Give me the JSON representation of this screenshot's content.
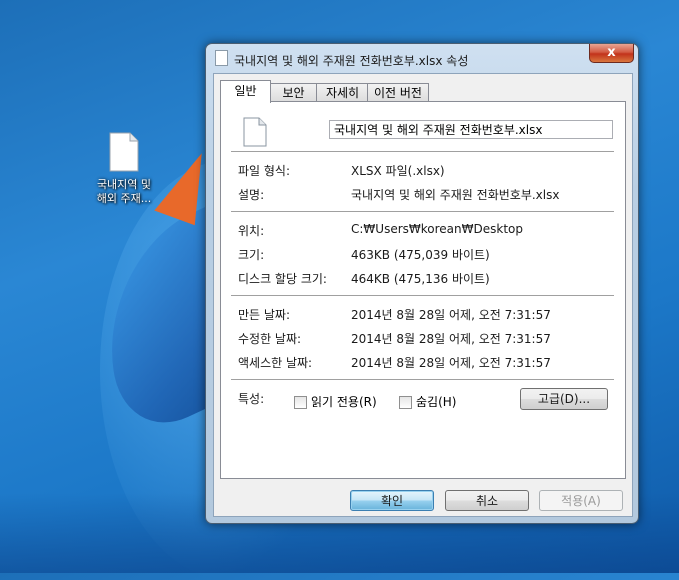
{
  "desktop": {
    "icon_label_line1": "국내지역 및",
    "icon_label_line2": "해외 주재..."
  },
  "window": {
    "title": "국내지역 및 해외 주재원 전화번호부.xlsx 속성",
    "close_label": "x"
  },
  "tabs": [
    {
      "label": "일반",
      "active": true
    },
    {
      "label": "보안",
      "active": false
    },
    {
      "label": "자세히",
      "active": false
    },
    {
      "label": "이전 버전",
      "active": false
    }
  ],
  "general": {
    "file_name": "국내지역 및 해외 주재원 전화번호부.xlsx",
    "file_type_label": "파일 형식:",
    "file_type_value": "XLSX 파일(.xlsx)",
    "description_label": "설명:",
    "description_value": "국내지역 및 해외 주재원 전화번호부.xlsx",
    "location_label": "위치:",
    "location_value": "C:₩Users₩korean₩Desktop",
    "size_label": "크기:",
    "size_value": "463KB (475,039 바이트)",
    "size_on_disk_label": "디스크 할당 크기:",
    "size_on_disk_value": "464KB (475,136 바이트)",
    "created_label": "만든 날짜:",
    "created_value": "2014년 8월 28일 어제, 오전 7:31:57",
    "modified_label": "수정한 날짜:",
    "modified_value": "2014년 8월 28일 어제, 오전 7:31:57",
    "accessed_label": "액세스한 날짜:",
    "accessed_value": "2014년 8월 28일 어제, 오전 7:31:57",
    "attributes_label": "특성:",
    "readonly_label": "읽기 전용(R)",
    "readonly_checked": false,
    "hidden_label": "숨김(H)",
    "hidden_checked": false,
    "advanced_button": "고급(D)..."
  },
  "footer": {
    "ok": "확인",
    "cancel": "취소",
    "apply": "적용(A)"
  }
}
